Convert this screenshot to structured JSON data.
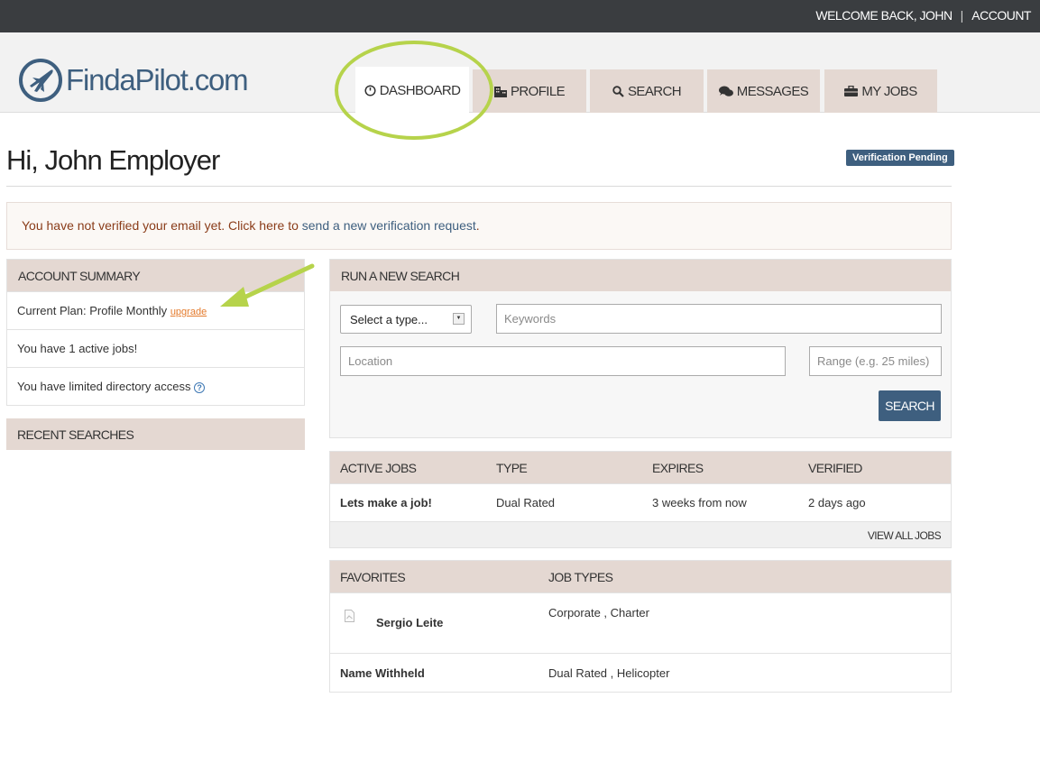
{
  "topbar": {
    "welcome": "WELCOME BACK, JOHN",
    "separator": "|",
    "account": "ACCOUNT"
  },
  "logo": {
    "text": "FindaPilot.com"
  },
  "nav": {
    "tabs": [
      {
        "label": "DASHBOARD",
        "icon": "dashboard-icon",
        "active": true
      },
      {
        "label": "PROFILE",
        "icon": "building-icon"
      },
      {
        "label": "SEARCH",
        "icon": "search-icon"
      },
      {
        "label": "MESSAGES",
        "icon": "chat-icon"
      },
      {
        "label": "MY JOBS",
        "icon": "briefcase-icon"
      }
    ]
  },
  "page": {
    "title": "Hi, John Employer",
    "badge": "Verification Pending"
  },
  "alert": {
    "prefix": "You have not verified your email yet. Click here to ",
    "link": "send a new verification request",
    "suffix": "."
  },
  "account_summary": {
    "title": "ACCOUNT SUMMARY",
    "plan": "Current Plan: Profile Monthly",
    "upgrade": "upgrade",
    "active_jobs": "You have 1 active jobs!",
    "directory": "You have limited directory access"
  },
  "recent_searches": {
    "title": "RECENT SEARCHES"
  },
  "search": {
    "title": "RUN A NEW SEARCH",
    "type_value": "Select a type...",
    "keywords_placeholder": "Keywords",
    "location_placeholder": "Location",
    "range_placeholder": "Range (e.g. 25 miles)",
    "button": "SEARCH"
  },
  "active_jobs": {
    "columns": [
      "ACTIVE JOBS",
      "TYPE",
      "EXPIRES",
      "VERIFIED"
    ],
    "rows": [
      {
        "name": "Lets make a job!",
        "type": "Dual Rated",
        "expires": "3 weeks from now",
        "verified": "2 days ago"
      }
    ],
    "view_all": "VIEW ALL JOBS"
  },
  "favorites": {
    "columns": [
      "FAVORITES",
      "JOB TYPES"
    ],
    "rows": [
      {
        "name": "Sergio Leite",
        "types": "Corporate , Charter"
      },
      {
        "name": "Name Withheld",
        "types": "Dual Rated , Helicopter"
      }
    ]
  },
  "colors": {
    "brand": "#3e5f7f",
    "panel_header": "#e4d8d2",
    "highlight": "#b6d34b",
    "alert_text": "#8a3c19",
    "link_orange": "#e47b2d"
  }
}
